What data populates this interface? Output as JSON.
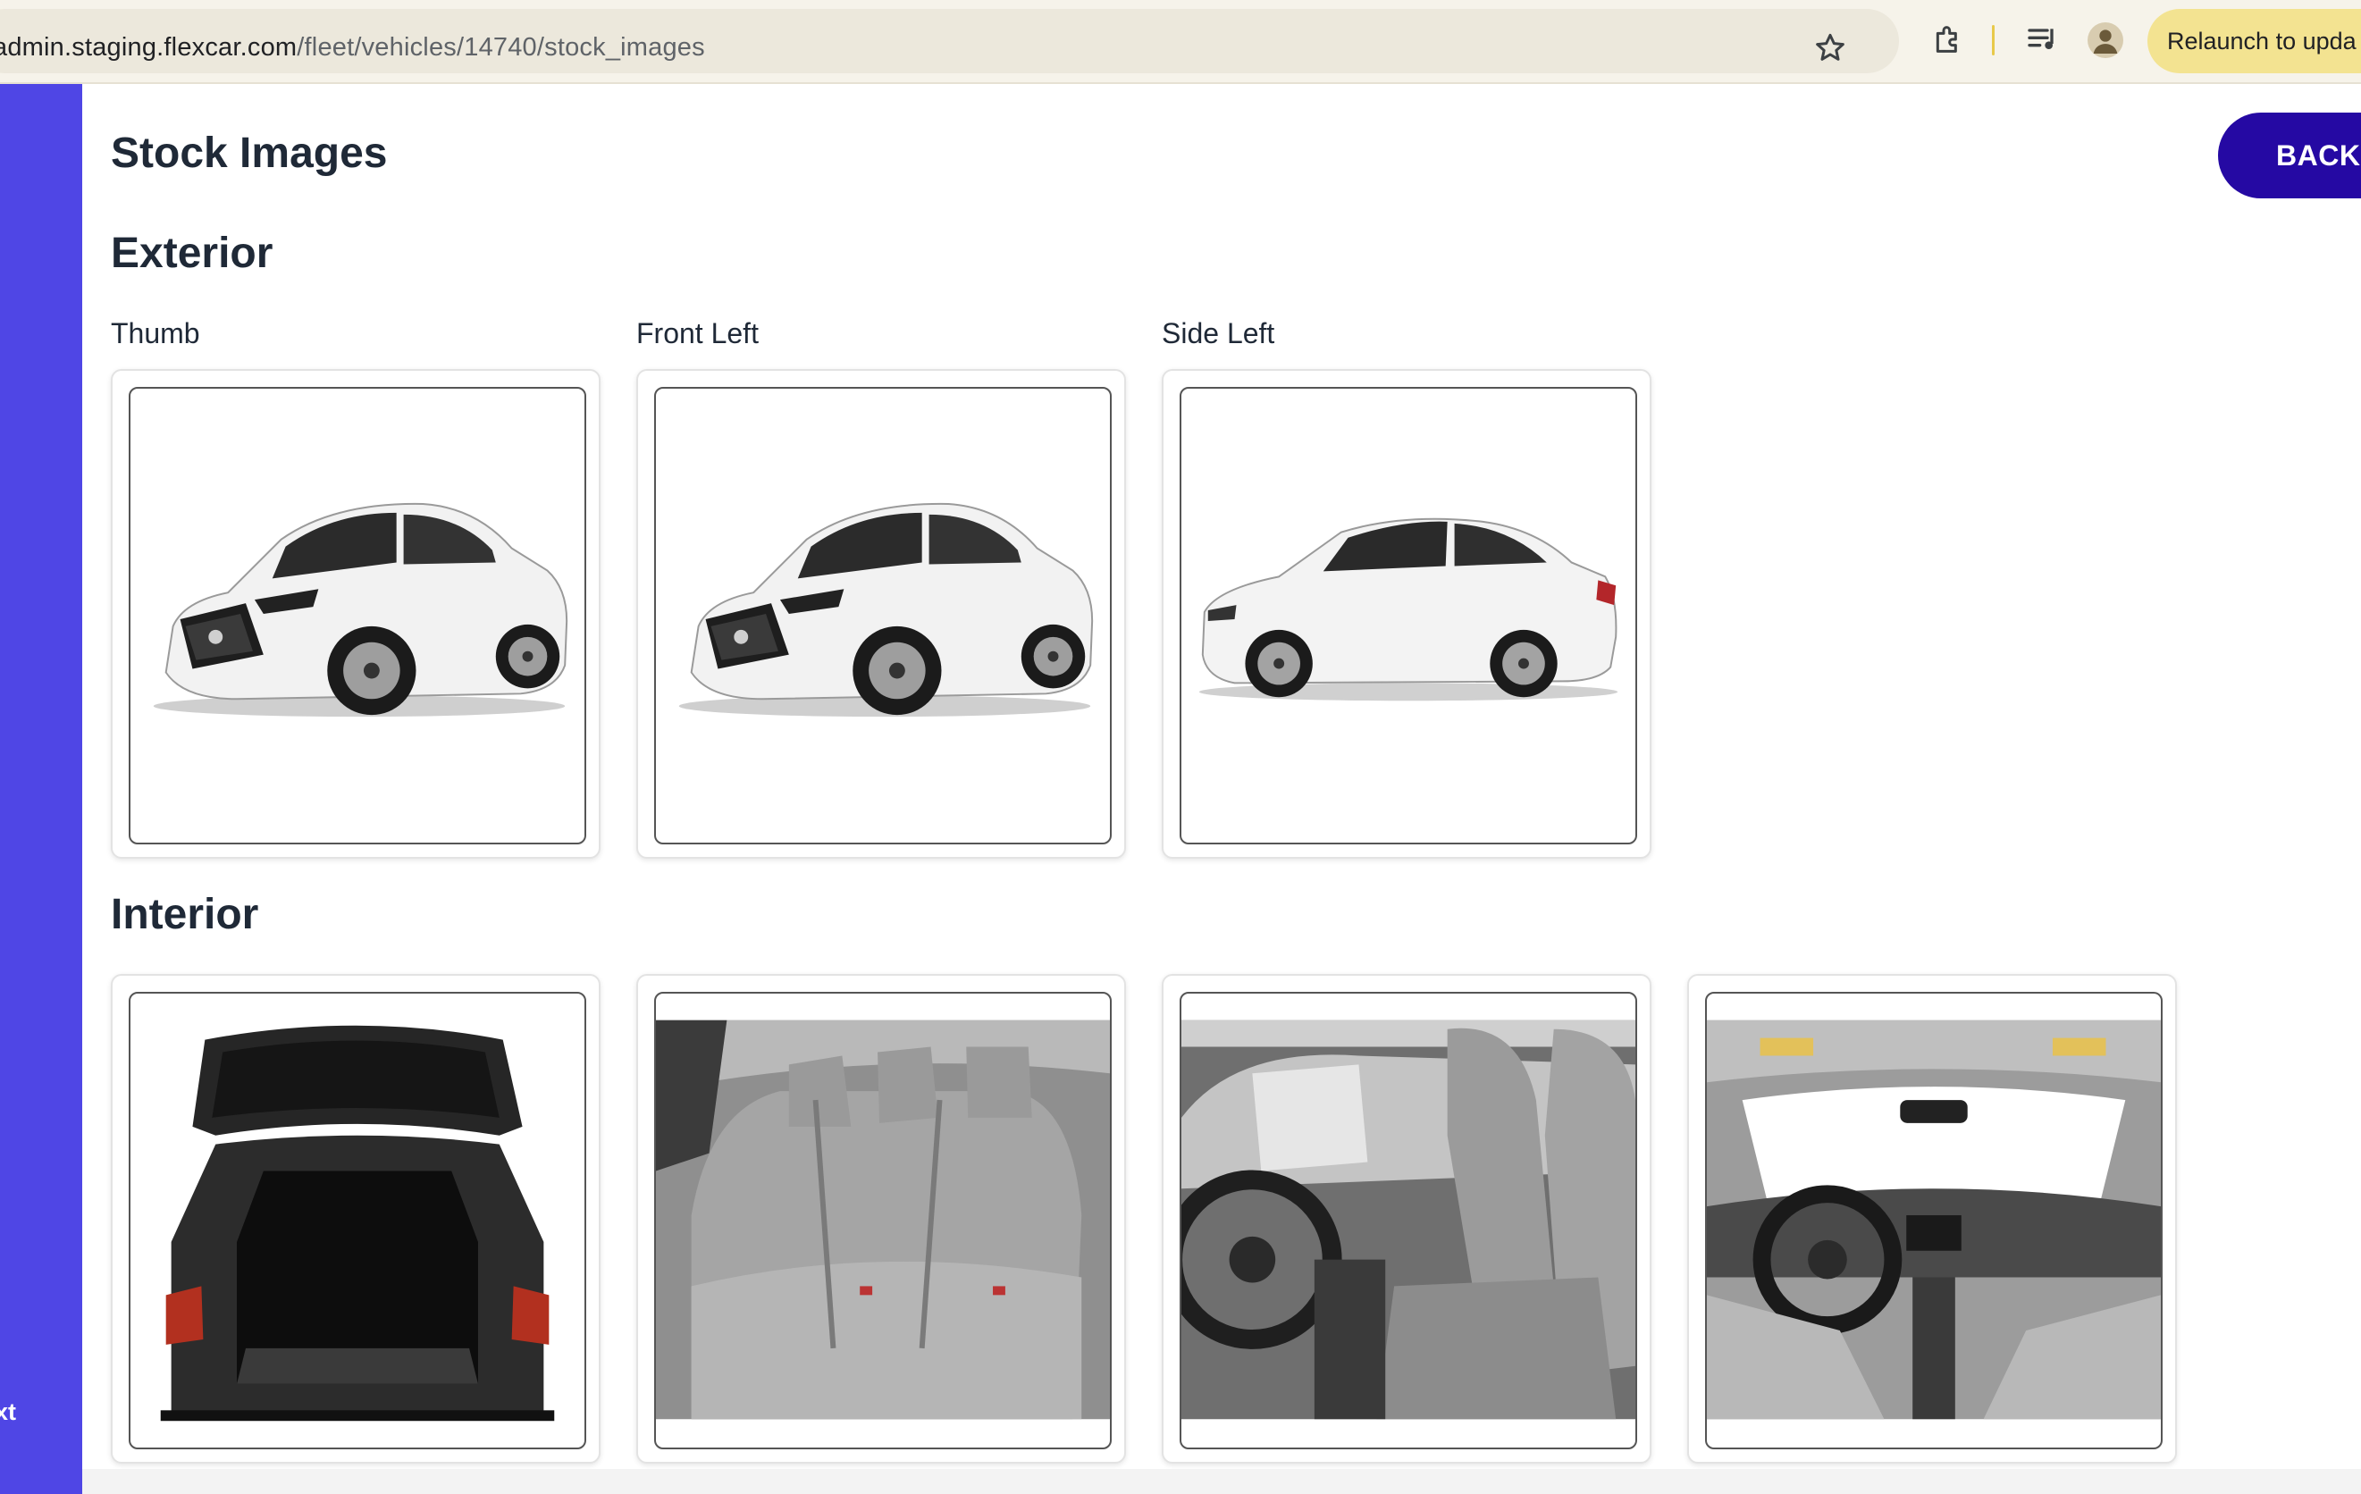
{
  "browser": {
    "url_host": "admin.staging.flexcar.com",
    "url_path": "/fleet/vehicles/14740/stock_images",
    "relaunch_label": "Relaunch to upda",
    "icons": [
      "bookmark-star-icon",
      "extensions-icon",
      "media-control-icon",
      "profile-avatar-icon"
    ]
  },
  "sidebar": {
    "partial_label": "xt",
    "color": "#4f46e5"
  },
  "page": {
    "title": "Stock Images",
    "back_label": "BACK",
    "back_color": "#2509a3"
  },
  "exterior": {
    "heading": "Exterior",
    "images": [
      {
        "label": "Thumb",
        "view": "front-three-quarter"
      },
      {
        "label": "Front Left",
        "view": "front-three-quarter"
      },
      {
        "label": "Side Left",
        "view": "side-profile"
      }
    ]
  },
  "interior": {
    "heading": "Interior",
    "images": [
      {
        "label": "",
        "view": "open-trunk"
      },
      {
        "label": "",
        "view": "rear-seats"
      },
      {
        "label": "",
        "view": "front-seats"
      },
      {
        "label": "",
        "view": "dashboard"
      }
    ]
  }
}
